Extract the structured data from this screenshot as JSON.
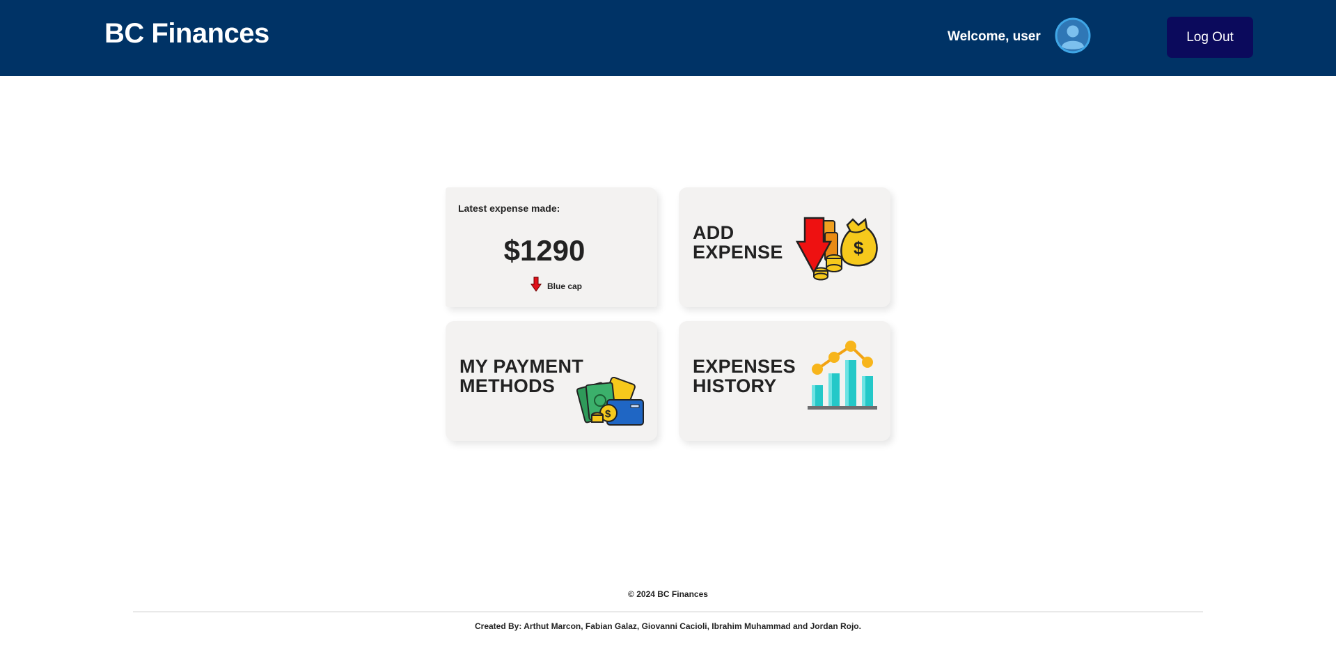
{
  "header": {
    "brand": "BC Finances",
    "welcome": "Welcome, user",
    "logout_label": "Log Out"
  },
  "latest_expense": {
    "title": "Latest expense made:",
    "amount": "$1290",
    "description": "Blue cap"
  },
  "cards": {
    "add_expense": {
      "line1": "ADD",
      "line2": "EXPENSE"
    },
    "payment_methods": {
      "line1": "MY PAYMENT",
      "line2": "METHODS"
    },
    "expenses_history": {
      "line1": "EXPENSES",
      "line2": "HISTORY"
    }
  },
  "footer": {
    "copyright": "© 2024 BC Finances",
    "credits": "Created By: Arthut Marcon, Fabian Galaz, Giovanni Cacioli, Ibrahim Muhammad and Jordan Rojo."
  },
  "colors": {
    "header_bg": "#003366",
    "logout_bg": "#0b0a5c",
    "card_bg": "#f3f2f1"
  },
  "icons": {
    "avatar": "user-avatar-icon",
    "expense_indicator": "red-down-arrow-icon",
    "add_expense": "money-bag-down-arrow-icon",
    "payment_methods": "cash-card-icon",
    "expenses_history": "bar-line-chart-icon"
  }
}
